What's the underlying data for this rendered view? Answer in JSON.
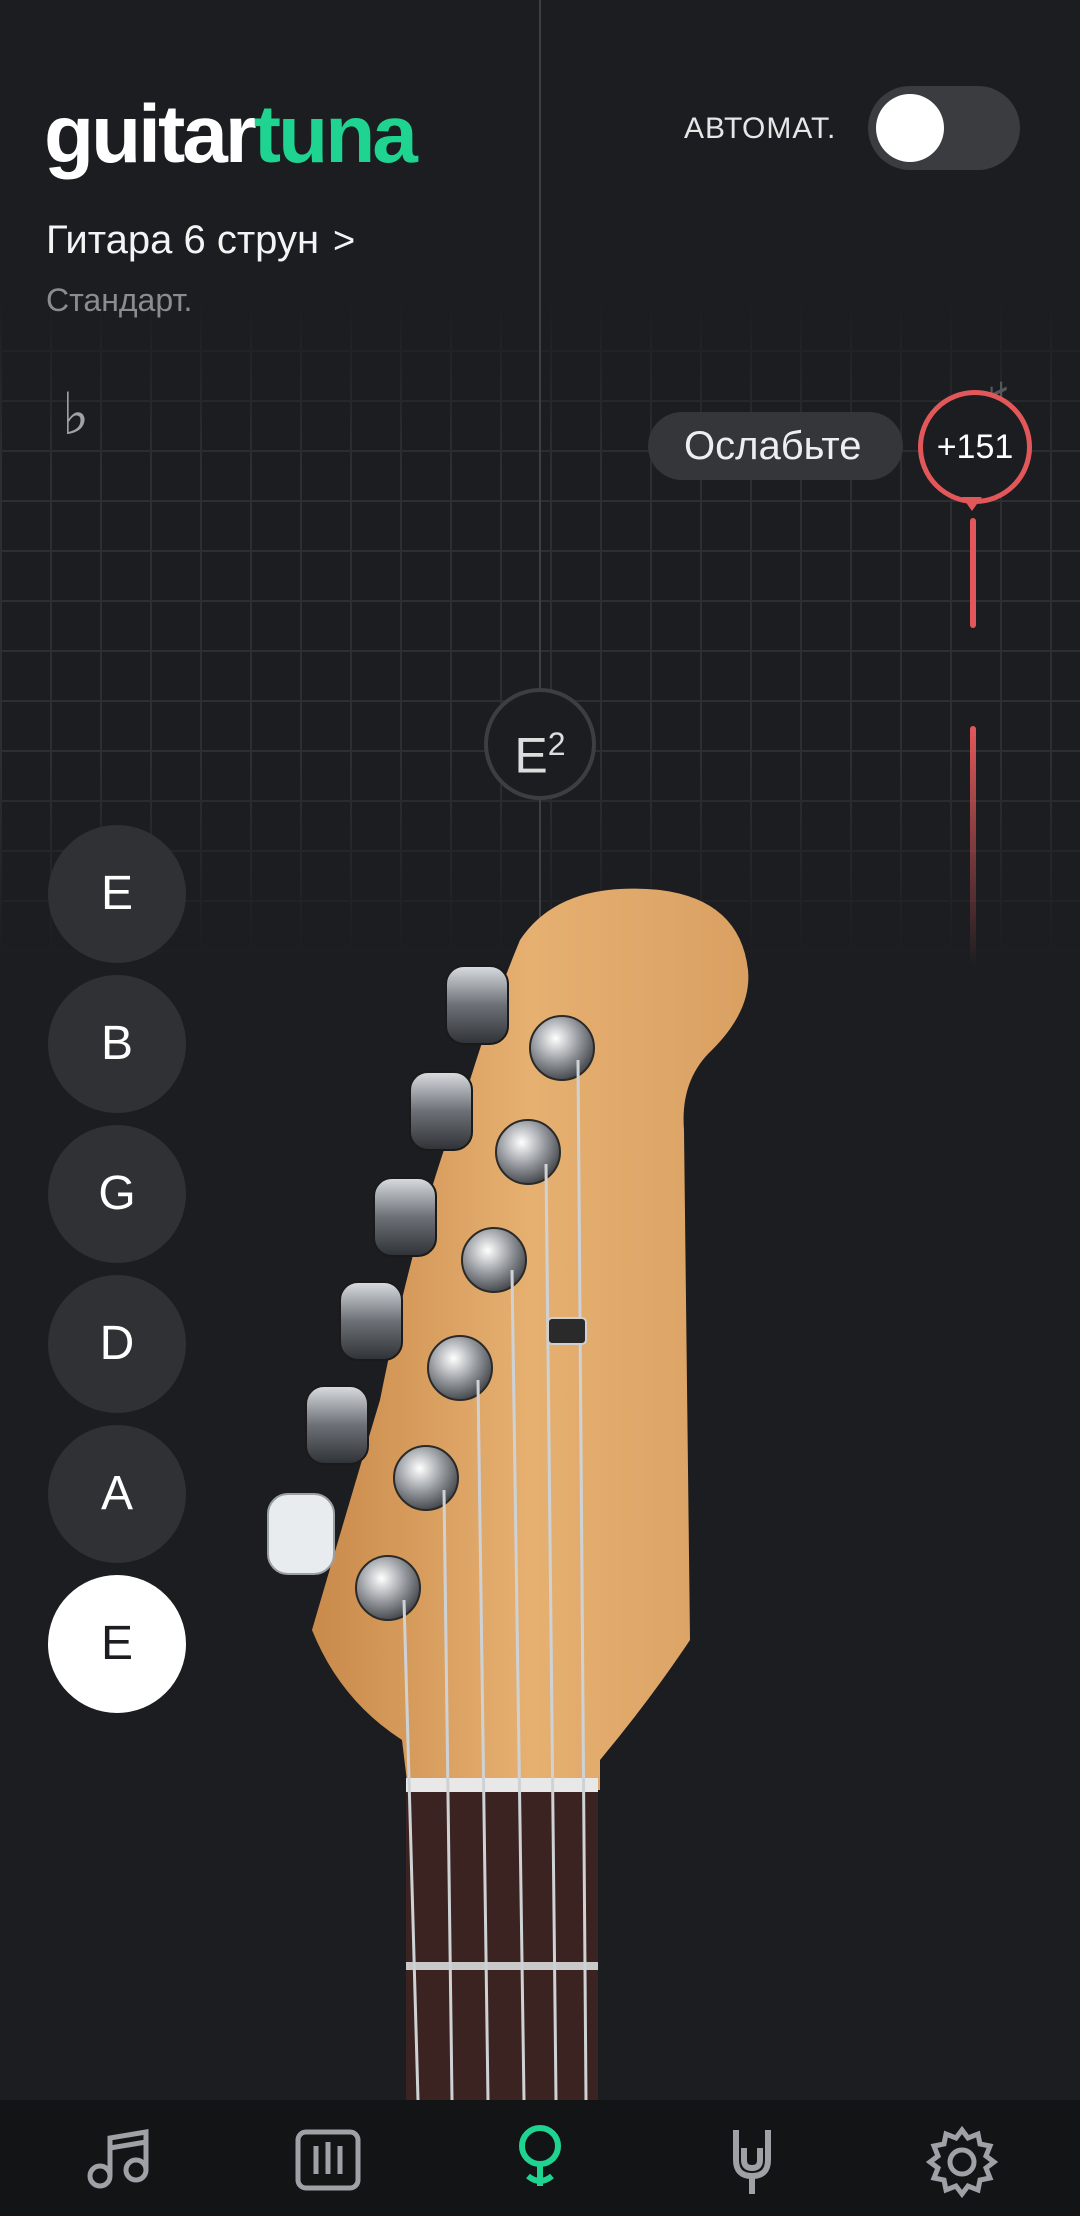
{
  "app": {
    "logo_part1": "guitar",
    "logo_part2": "tuna"
  },
  "header": {
    "auto_label": "АВТОМАТ.",
    "auto_enabled": false
  },
  "instrument": {
    "name": "Гитара 6 струн",
    "tuning": "Стандарт."
  },
  "tuner": {
    "flat_symbol": "♭",
    "sharp_symbol": "♯",
    "hint": "Ослабьте",
    "cents": "+151",
    "note_letter": "E",
    "note_octave": "2"
  },
  "strings": [
    {
      "label": "E",
      "selected": false
    },
    {
      "label": "B",
      "selected": false
    },
    {
      "label": "G",
      "selected": false
    },
    {
      "label": "D",
      "selected": false
    },
    {
      "label": "A",
      "selected": false
    },
    {
      "label": "E",
      "selected": true
    }
  ],
  "nav": [
    {
      "icon": "music-note-icon",
      "active": false
    },
    {
      "icon": "metronome-icon",
      "active": false
    },
    {
      "icon": "tuner-icon",
      "active": true
    },
    {
      "icon": "tune-fork-icon",
      "active": false
    },
    {
      "icon": "gear-icon",
      "active": false
    }
  ],
  "colors": {
    "accent": "#1ed490",
    "warning": "#e2585a",
    "background": "#1c1d20"
  }
}
